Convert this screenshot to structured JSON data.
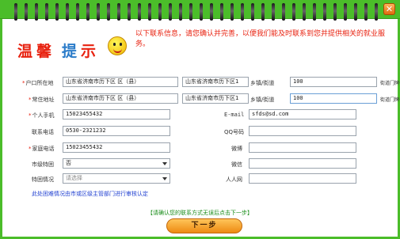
{
  "window": {
    "close_glyph": "✕"
  },
  "logo": {
    "chars": [
      "温",
      "馨",
      "提",
      "示"
    ]
  },
  "notice": "以下联系信息，请您确认并完善，以便我们能及时联系到您并提供相关的就业服务。",
  "form": {
    "hukou": {
      "label": "户口所在地",
      "province_city_district": "山东省济南市历下区 区（县）",
      "street": "山东省济南市历下区1",
      "town_label": "乡镇/街道",
      "house_number": "100",
      "house_number_label": "街道门牌号"
    },
    "residence": {
      "label": "常住地址",
      "province_city_district": "山东省济南市历下区 区（县）",
      "street": "山东省济南市历下区1",
      "town_label": "乡镇/街道",
      "house_number": "100",
      "house_number_label": "街道门牌号"
    },
    "mobile": {
      "label": "个人手机",
      "value": "15023455432"
    },
    "email": {
      "label": "E-mail",
      "value": "sfds@sd.com"
    },
    "phone": {
      "label": "联系电话",
      "value": "0530-2321232"
    },
    "qq": {
      "label": "QQ号码",
      "value": ""
    },
    "home_phone": {
      "label": "家庭电话",
      "value": "15023455432"
    },
    "weibo": {
      "label": "微博",
      "value": ""
    },
    "city_special": {
      "label": "市级特困",
      "value": "否"
    },
    "wechat": {
      "label": "微信",
      "value": ""
    },
    "special_status": {
      "label": "特困情况",
      "placeholder": "请选择"
    },
    "renrenwang": {
      "label": "人人网",
      "value": ""
    }
  },
  "note": "此处困难情况由市或区级主管部门进行审核认定",
  "hint": "【请确认您的联系方式无误后点击下一步】",
  "next_button": "下一步"
}
